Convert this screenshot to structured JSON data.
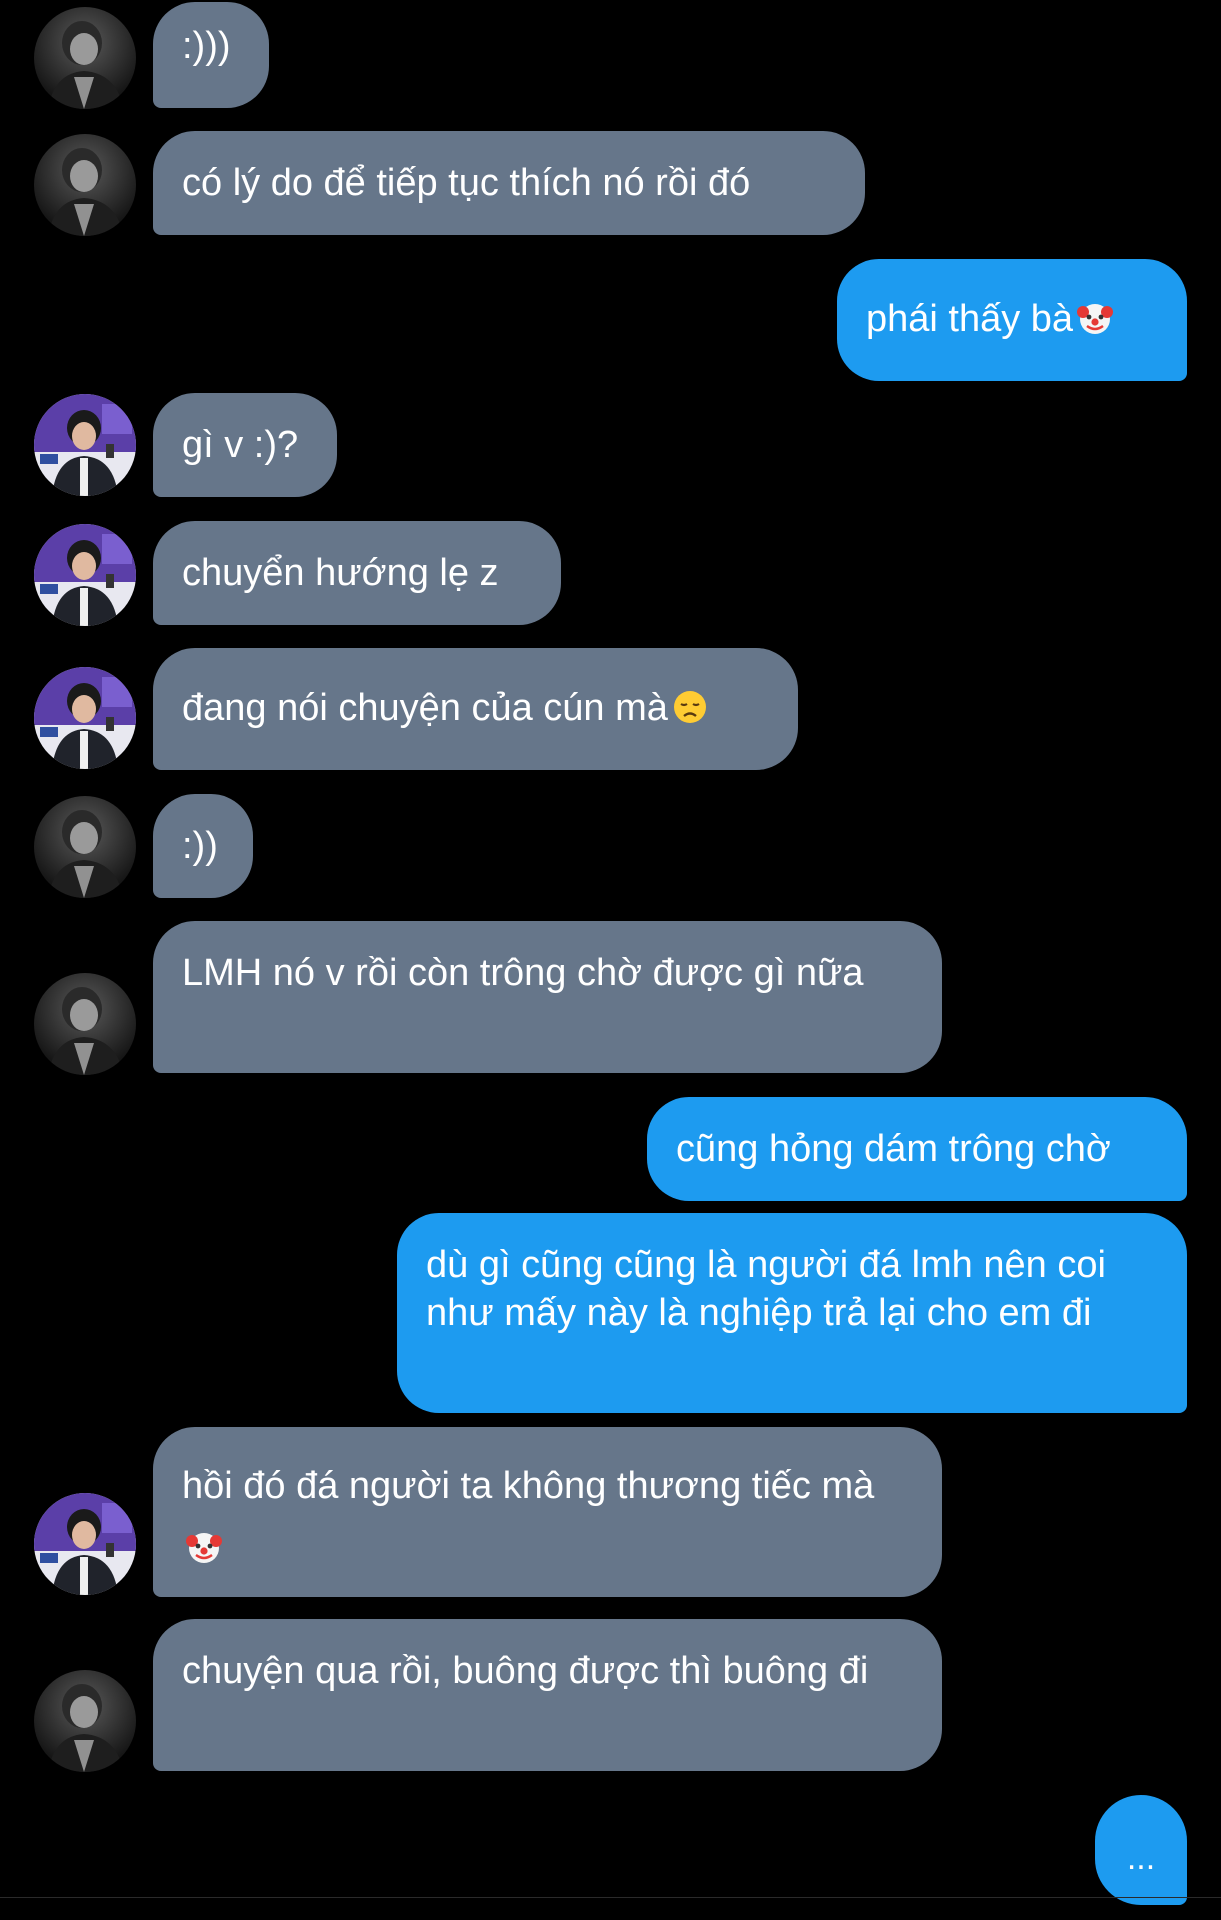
{
  "messages": [
    {
      "side": "in",
      "avatar": "mono",
      "text": ":)))"
    },
    {
      "side": "in",
      "avatar": "mono",
      "text": "có lý do để tiếp tục thích nó rồi đó"
    },
    {
      "side": "out",
      "text": "phái thấy bà",
      "emoji": "clown-emoji"
    },
    {
      "side": "in",
      "avatar": "purple",
      "text": "gì v :)?"
    },
    {
      "side": "in",
      "avatar": "purple",
      "text": "chuyển hướng lẹ z"
    },
    {
      "side": "in",
      "avatar": "purple",
      "text": "đang nói chuyện của cún mà",
      "emoji": "disappointed-face-emoji"
    },
    {
      "side": "in",
      "avatar": "mono",
      "text": ":))"
    },
    {
      "side": "in",
      "avatar": "mono",
      "text": "LMH nó v rồi còn trông chờ được gì nữa"
    },
    {
      "side": "out",
      "text": "cũng hỏng dám trông chờ"
    },
    {
      "side": "out",
      "text": "dù gì cũng cũng là người đá lmh nên coi như mấy này là nghiệp trả lại cho em đi"
    },
    {
      "side": "in",
      "avatar": "purple",
      "text": "hồi đó đá người ta không thương tiếc mà",
      "emoji": "clown-emoji"
    },
    {
      "side": "in",
      "avatar": "mono",
      "text": "chuyện qua rồi, buông được thì buông đi"
    }
  ],
  "typing_indicator": "...",
  "colors": {
    "incoming_bubble": "#66768a",
    "outgoing_bubble": "#1d9bf0",
    "background": "#000000",
    "text": "#ffffff"
  }
}
